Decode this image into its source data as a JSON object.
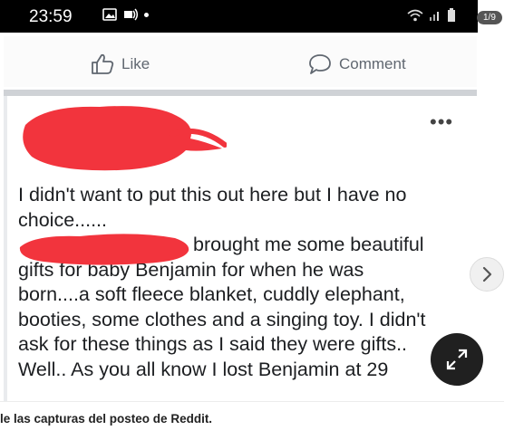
{
  "status_bar": {
    "time": "23:59"
  },
  "image_counter": "1/9",
  "reactions": {
    "like_label": "Like",
    "comment_label": "Comment"
  },
  "post": {
    "more_glyph": "•••",
    "line1": "I didn't want to put this out here but I have no",
    "line2": "choice......",
    "line3": "brought me some beautiful",
    "line4": "gifts for baby Benjamin for when he was",
    "line5": "born....a soft fleece blanket, cuddly elephant,",
    "line6": "booties, some clothes and a singing toy. I didn't",
    "line7": "ask for these things as I said they were gifts..",
    "line8": "Well.. As you all know I lost Benjamin at 29"
  },
  "caption": "le las capturas del posteo de Reddit.",
  "colors": {
    "redaction": "#f2343d",
    "icon_gray": "#606770"
  },
  "icons": [
    "thumbs-up-icon",
    "comment-icon",
    "more-icon",
    "chevron-right-icon",
    "expand-icon"
  ]
}
